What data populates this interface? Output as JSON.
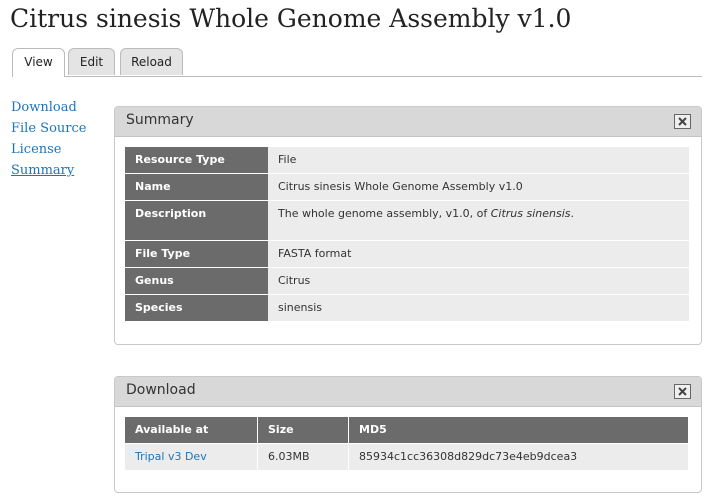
{
  "page": {
    "title": "Citrus sinesis Whole Genome Assembly v1.0"
  },
  "tabs": [
    {
      "label": "View",
      "active": true
    },
    {
      "label": "Edit",
      "active": false
    },
    {
      "label": "Reload",
      "active": false
    }
  ],
  "side_nav": [
    {
      "label": "Download"
    },
    {
      "label": "File Source"
    },
    {
      "label": "License"
    },
    {
      "label": "Summary",
      "current": true
    }
  ],
  "summary": {
    "title": "Summary",
    "rows": {
      "resource_type": {
        "label": "Resource Type",
        "value": "File"
      },
      "name": {
        "label": "Name",
        "value": "Citrus sinesis Whole Genome Assembly v1.0"
      },
      "description": {
        "label": "Description",
        "prefix": "The whole genome assembly, v1.0, of ",
        "italic": "Citrus sinensis",
        "suffix": "."
      },
      "file_type": {
        "label": "File Type",
        "value": "FASTA format"
      },
      "genus": {
        "label": "Genus",
        "value": "Citrus"
      },
      "species": {
        "label": "Species",
        "value": "sinensis"
      }
    }
  },
  "download": {
    "title": "Download",
    "columns": {
      "available_at": "Available at",
      "size": "Size",
      "md5": "MD5"
    },
    "rows": [
      {
        "available_at": "Tripal v3 Dev",
        "size": "6.03MB",
        "md5": "85934c1cc36308d829dc73e4eb9dcea3"
      }
    ]
  },
  "icons": {
    "panel_close": "close-icon"
  },
  "colors": {
    "link": "#1b75bb",
    "header_cell": "#6b6b6b",
    "panel_header": "#d8d8d8",
    "cell_bg": "#ececec"
  }
}
